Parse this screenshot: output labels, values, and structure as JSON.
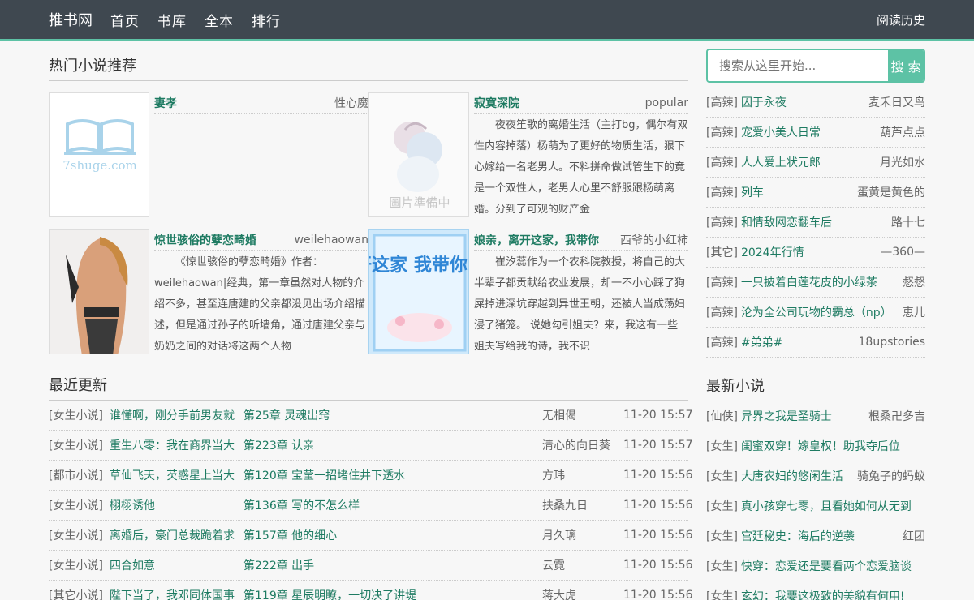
{
  "header": {
    "logo": "推书网",
    "nav": [
      "首页",
      "书库",
      "全本",
      "排行"
    ],
    "history": "阅读历史"
  },
  "hot": {
    "title": "热门小说推荐",
    "books": [
      {
        "title": "妻孝",
        "author": "性心魔",
        "desc": "",
        "cover_text": "7shuge.com"
      },
      {
        "title": "寂寞深院",
        "author": "popular",
        "desc": "夜夜笙歌的离婚生活（主打bg，偶尔有双性内容掉落）杨萌为了更好的物质生活，狠下心嫁给一名老男人。不料拼命做试管生下的竟是一个双性人，老男人心里不舒服跟杨萌离婚。分到了可观的财产金",
        "cover_text": "圖片準備中"
      },
      {
        "title": "惊世骇俗的孽恋畸婚",
        "author": "weilehaowan",
        "desc": "《惊世骇俗的孽恋畸婚》作者：weilehaowan|经典，第一章虽然对人物的介绍不多，甚至连唐建的父亲都没见出场介绍描述，但是通过孙子的听墙角，通过唐建父亲与奶奶之间的对话将这两个人物",
        "cover_text": ""
      },
      {
        "title": "娘亲，离开这家，我带你",
        "author": "西爷的小红柿",
        "desc": "崔汐蕊作为一个农科院教授，将自己的大半辈子都贡献给农业发展，却一不小心踩了狗屎掉进深坑穿越到异世王朝，还被人当成荡妇浸了猪笼。 说她勾引姐夫？来，我这有一些姐夫写给我的诗，我不识",
        "cover_text": "娘亲 离开这家 我带你 吃香喝辣"
      }
    ]
  },
  "search": {
    "placeholder": "搜索从这里开始...",
    "button": "搜 索"
  },
  "ranking": [
    {
      "cat": "[高辣]",
      "name": "囚于永夜",
      "author": "麦禾日又鸟"
    },
    {
      "cat": "[高辣]",
      "name": "宠爱小美人日常",
      "author": "葫芦点点"
    },
    {
      "cat": "[高辣]",
      "name": "人人爱上状元郎",
      "author": "月光如水"
    },
    {
      "cat": "[高辣]",
      "name": "列车",
      "author": "蛋黄是黄色的"
    },
    {
      "cat": "[高辣]",
      "name": "和情敌网恋翻车后",
      "author": "路十七"
    },
    {
      "cat": "[其它]",
      "name": "2024年行情",
      "author": "—360—"
    },
    {
      "cat": "[高辣]",
      "name": "一只披着白莲花皮的小绿茶",
      "author": "惄惄"
    },
    {
      "cat": "[高辣]",
      "name": "沦为全公司玩物的霸总（np）",
      "author": "恵儿"
    },
    {
      "cat": "[高辣]",
      "name": "#弟弟#",
      "author": "18upstories"
    }
  ],
  "updates": {
    "title": "最近更新",
    "rows": [
      {
        "cat": "[女生小说]",
        "book": "谁懂啊，刚分手前男友就",
        "chapter": "第25章 灵魂出窍",
        "author": "无相偈",
        "time": "11-20 15:57"
      },
      {
        "cat": "[女生小说]",
        "book": "重生八零：我在商界当大",
        "chapter": "第223章 认亲",
        "author": "清心的向日葵",
        "time": "11-20 15:57"
      },
      {
        "cat": "[都市小说]",
        "book": "草仙飞天，芡惑星上当大",
        "chapter": "第120章 宝莹一招堵住井下透水",
        "author": "方玮",
        "time": "11-20 15:56"
      },
      {
        "cat": "[女生小说]",
        "book": "栩栩诱他",
        "chapter": "第136章 写的不怎么样",
        "author": "扶桑九日",
        "time": "11-20 15:56"
      },
      {
        "cat": "[女生小说]",
        "book": "离婚后，豪门总裁跪着求",
        "chapter": "第157章 他的细心",
        "author": "月久璃",
        "time": "11-20 15:56"
      },
      {
        "cat": "[女生小说]",
        "book": "四合如意",
        "chapter": "第222章 出手",
        "author": "云霓",
        "time": "11-20 15:56"
      },
      {
        "cat": "[其它小说]",
        "book": "陛下当了，我邓同体国事",
        "chapter": "第119章 星辰明瞭，一切决了讲堤",
        "author": "蒋大虎",
        "time": "11-20 15:56"
      }
    ]
  },
  "newnovels": {
    "title": "最新小说",
    "rows": [
      {
        "cat": "[仙侠]",
        "name": "异界之我是圣骑士",
        "author": "根桑卍多吉"
      },
      {
        "cat": "[女生]",
        "name": "闺蜜双穿！嫁皇权！助我夺后位",
        "author": ""
      },
      {
        "cat": "[女生]",
        "name": "大唐农妇的悠闲生活",
        "author": "骑兔子的蚂蚁"
      },
      {
        "cat": "[女生]",
        "name": "真小孩穿七零，且看她如何从无到",
        "author": ""
      },
      {
        "cat": "[女生]",
        "name": "宫廷秘史：海后的逆袭",
        "author": "红团"
      },
      {
        "cat": "[女生]",
        "name": "快穿：恋爱还是要看两个恋爱脑谈",
        "author": ""
      },
      {
        "cat": "[女生]",
        "name": "玄幻：我要这极致的美貌有何用!",
        "author": ""
      }
    ]
  },
  "colors": {
    "accent": "#5dc2a5",
    "topbar": "#3f4850",
    "link": "#1e7b62"
  }
}
